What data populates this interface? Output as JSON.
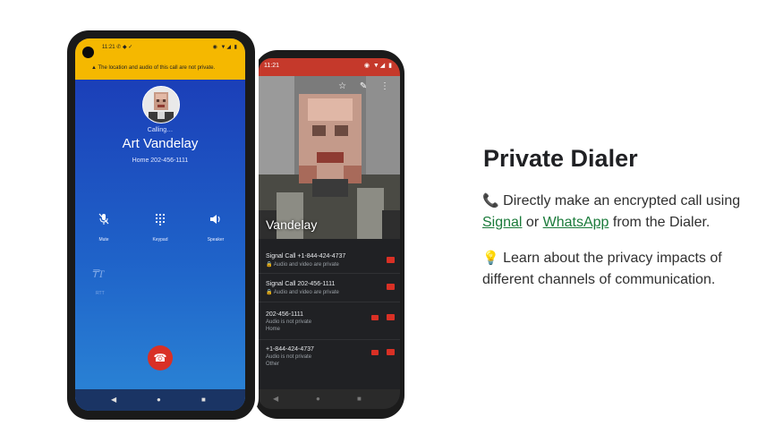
{
  "front_phone": {
    "status_time": "11:21",
    "status_icons": "✆ ◆ ✓",
    "status_right": "◉ ▼◢ ▮",
    "warning": "▲  The location and audio of this call are not private.",
    "calling": "Calling…",
    "caller_name": "Art Vandelay",
    "caller_number": "Home 202-456-1111",
    "controls": [
      {
        "icon": "mic-off-icon",
        "glyph": "🎙",
        "label": "Mute"
      },
      {
        "icon": "keypad-icon",
        "glyph": "⠿",
        "label": "Keypad"
      },
      {
        "icon": "speaker-icon",
        "glyph": "🔊",
        "label": "Speaker"
      }
    ],
    "tty_glyph": "₸T",
    "tty_label": "RTT",
    "endcall_glyph": "☎",
    "nav": [
      "◀",
      "●",
      "■"
    ]
  },
  "back_phone": {
    "status_time": "11:21",
    "status_right": "◉ ▼◢ ▮",
    "actions": "☆ ✎ ⋮",
    "contact_name": "Vandelay",
    "channels": [
      {
        "title": "Signal Call +1-844-424-4737",
        "subtitle": "🔒 Audio and video are private"
      },
      {
        "title": "Signal Call 202-456-1111",
        "subtitle": "🔒 Audio and video are private"
      },
      {
        "title": "202-456-1111",
        "subtitle": "Audio is not private",
        "type": "Home"
      },
      {
        "title": "+1-844-424-4737",
        "subtitle": "Audio is not private",
        "type": "Other"
      }
    ],
    "nav": [
      "◀",
      "●",
      "■"
    ]
  },
  "feature": {
    "title": "Private Dialer",
    "p1_emoji": "📞",
    "p1_before": " Directly make an encrypted call using ",
    "p1_link1": "Signal",
    "p1_mid": " or ",
    "p1_link2": "WhatsApp",
    "p1_after": " from the Dialer.",
    "p2_emoji": "💡",
    "p2_text": " Learn about the privacy impacts of different channels of communication."
  },
  "colors": {
    "status_yellow": "#f5b800",
    "call_blue": "#1f4cc1",
    "end_call_red": "#d93025",
    "back_status_red": "#c5392b",
    "link_green": "#1a7a3a"
  }
}
